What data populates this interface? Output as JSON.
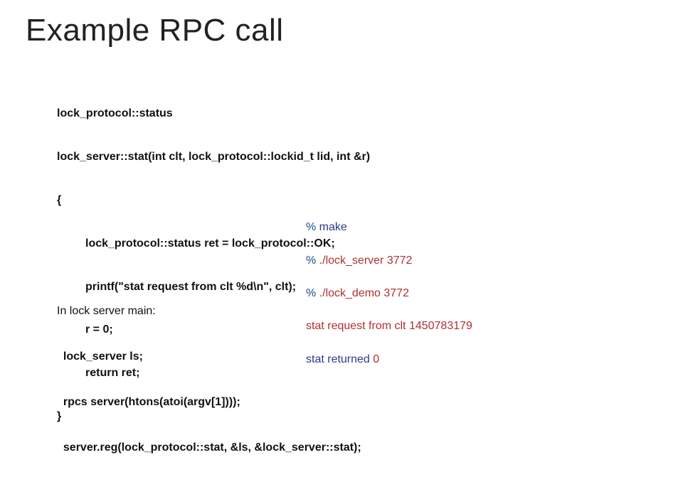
{
  "title": "Example RPC call",
  "code": {
    "l1": "lock_protocol::status",
    "l2": "lock_server::stat(int clt, lock_protocol::lockid_t lid, int &r)",
    "l3": "{",
    "l4": "lock_protocol::status ret = lock_protocol::OK;",
    "l5": "printf(\"stat request from clt %d\\n\", clt);",
    "l6": "r = 0;",
    "l7": "return ret;",
    "l8": "}"
  },
  "sub": {
    "heading": "In lock server main:",
    "s1": "lock_server ls;",
    "s2": "rpcs server(htons(atoi(argv[1])));",
    "s3": "server.reg(lock_protocol::stat, &ls, &lock_server::stat);"
  },
  "terminal": {
    "t1a": "% ",
    "t1b": "make",
    "t2a": "% ",
    "t2b": "./lock_server 3772",
    "t3a": "% ",
    "t3b": "./lock_demo 3772",
    "t4": "stat request from clt 1450783179",
    "t5a": "stat returned ",
    "t5b": "0"
  }
}
